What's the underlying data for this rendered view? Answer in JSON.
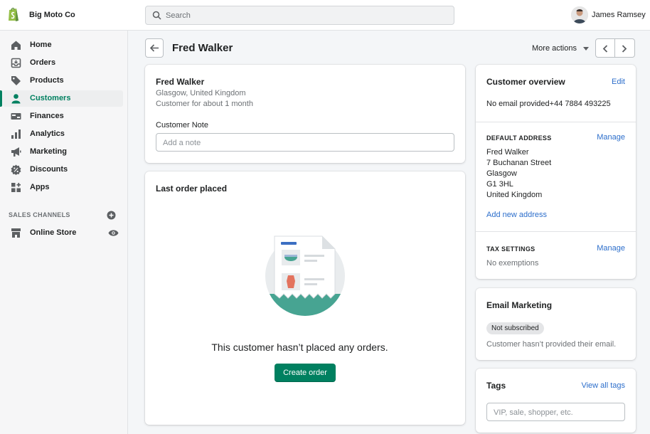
{
  "topbar": {
    "store_name": "Big Moto Co",
    "search_placeholder": "Search",
    "user_name": "James Ramsey"
  },
  "sidebar": {
    "items": [
      {
        "label": "Home",
        "icon": "home-icon"
      },
      {
        "label": "Orders",
        "icon": "orders-icon"
      },
      {
        "label": "Products",
        "icon": "tag-icon"
      },
      {
        "label": "Customers",
        "icon": "person-icon",
        "active": true
      },
      {
        "label": "Finances",
        "icon": "finances-icon"
      },
      {
        "label": "Analytics",
        "icon": "bar-chart-icon"
      },
      {
        "label": "Marketing",
        "icon": "megaphone-icon"
      },
      {
        "label": "Discounts",
        "icon": "discount-icon"
      },
      {
        "label": "Apps",
        "icon": "apps-icon"
      }
    ],
    "sales_channels_title": "SALES CHANNELS",
    "online_store_label": "Online Store"
  },
  "page": {
    "title": "Fred Walker",
    "more_actions": "More actions"
  },
  "customer_card": {
    "name": "Fred Walker",
    "location": "Glasgow, United Kingdom",
    "tenure": "Customer for about 1 month",
    "note_label": "Customer Note",
    "note_placeholder": "Add a note"
  },
  "orders_card": {
    "title": "Last order placed",
    "empty_message": "This customer hasn’t placed any orders.",
    "create_order_label": "Create order"
  },
  "overview_card": {
    "title": "Customer overview",
    "edit_label": "Edit",
    "contact": "No email provided+44 7884 493225",
    "default_address_title": "DEFAULT ADDRESS",
    "manage_label": "Manage",
    "address_lines": [
      "Fred Walker",
      "7 Buchanan Street",
      "Glasgow",
      "G1 3HL",
      "United Kingdom"
    ],
    "add_address_label": "Add new address",
    "tax_settings_title": "TAX SETTINGS",
    "tax_manage_label": "Manage",
    "tax_value": "No exemptions"
  },
  "email_card": {
    "title": "Email Marketing",
    "status_badge": "Not subscribed",
    "note": "Customer hasn’t provided their email."
  },
  "tags_card": {
    "title": "Tags",
    "view_all_label": "View all tags",
    "placeholder": "VIP, sale, shopper, etc."
  },
  "colors": {
    "accent": "#008060",
    "link": "#2c6ecb"
  }
}
